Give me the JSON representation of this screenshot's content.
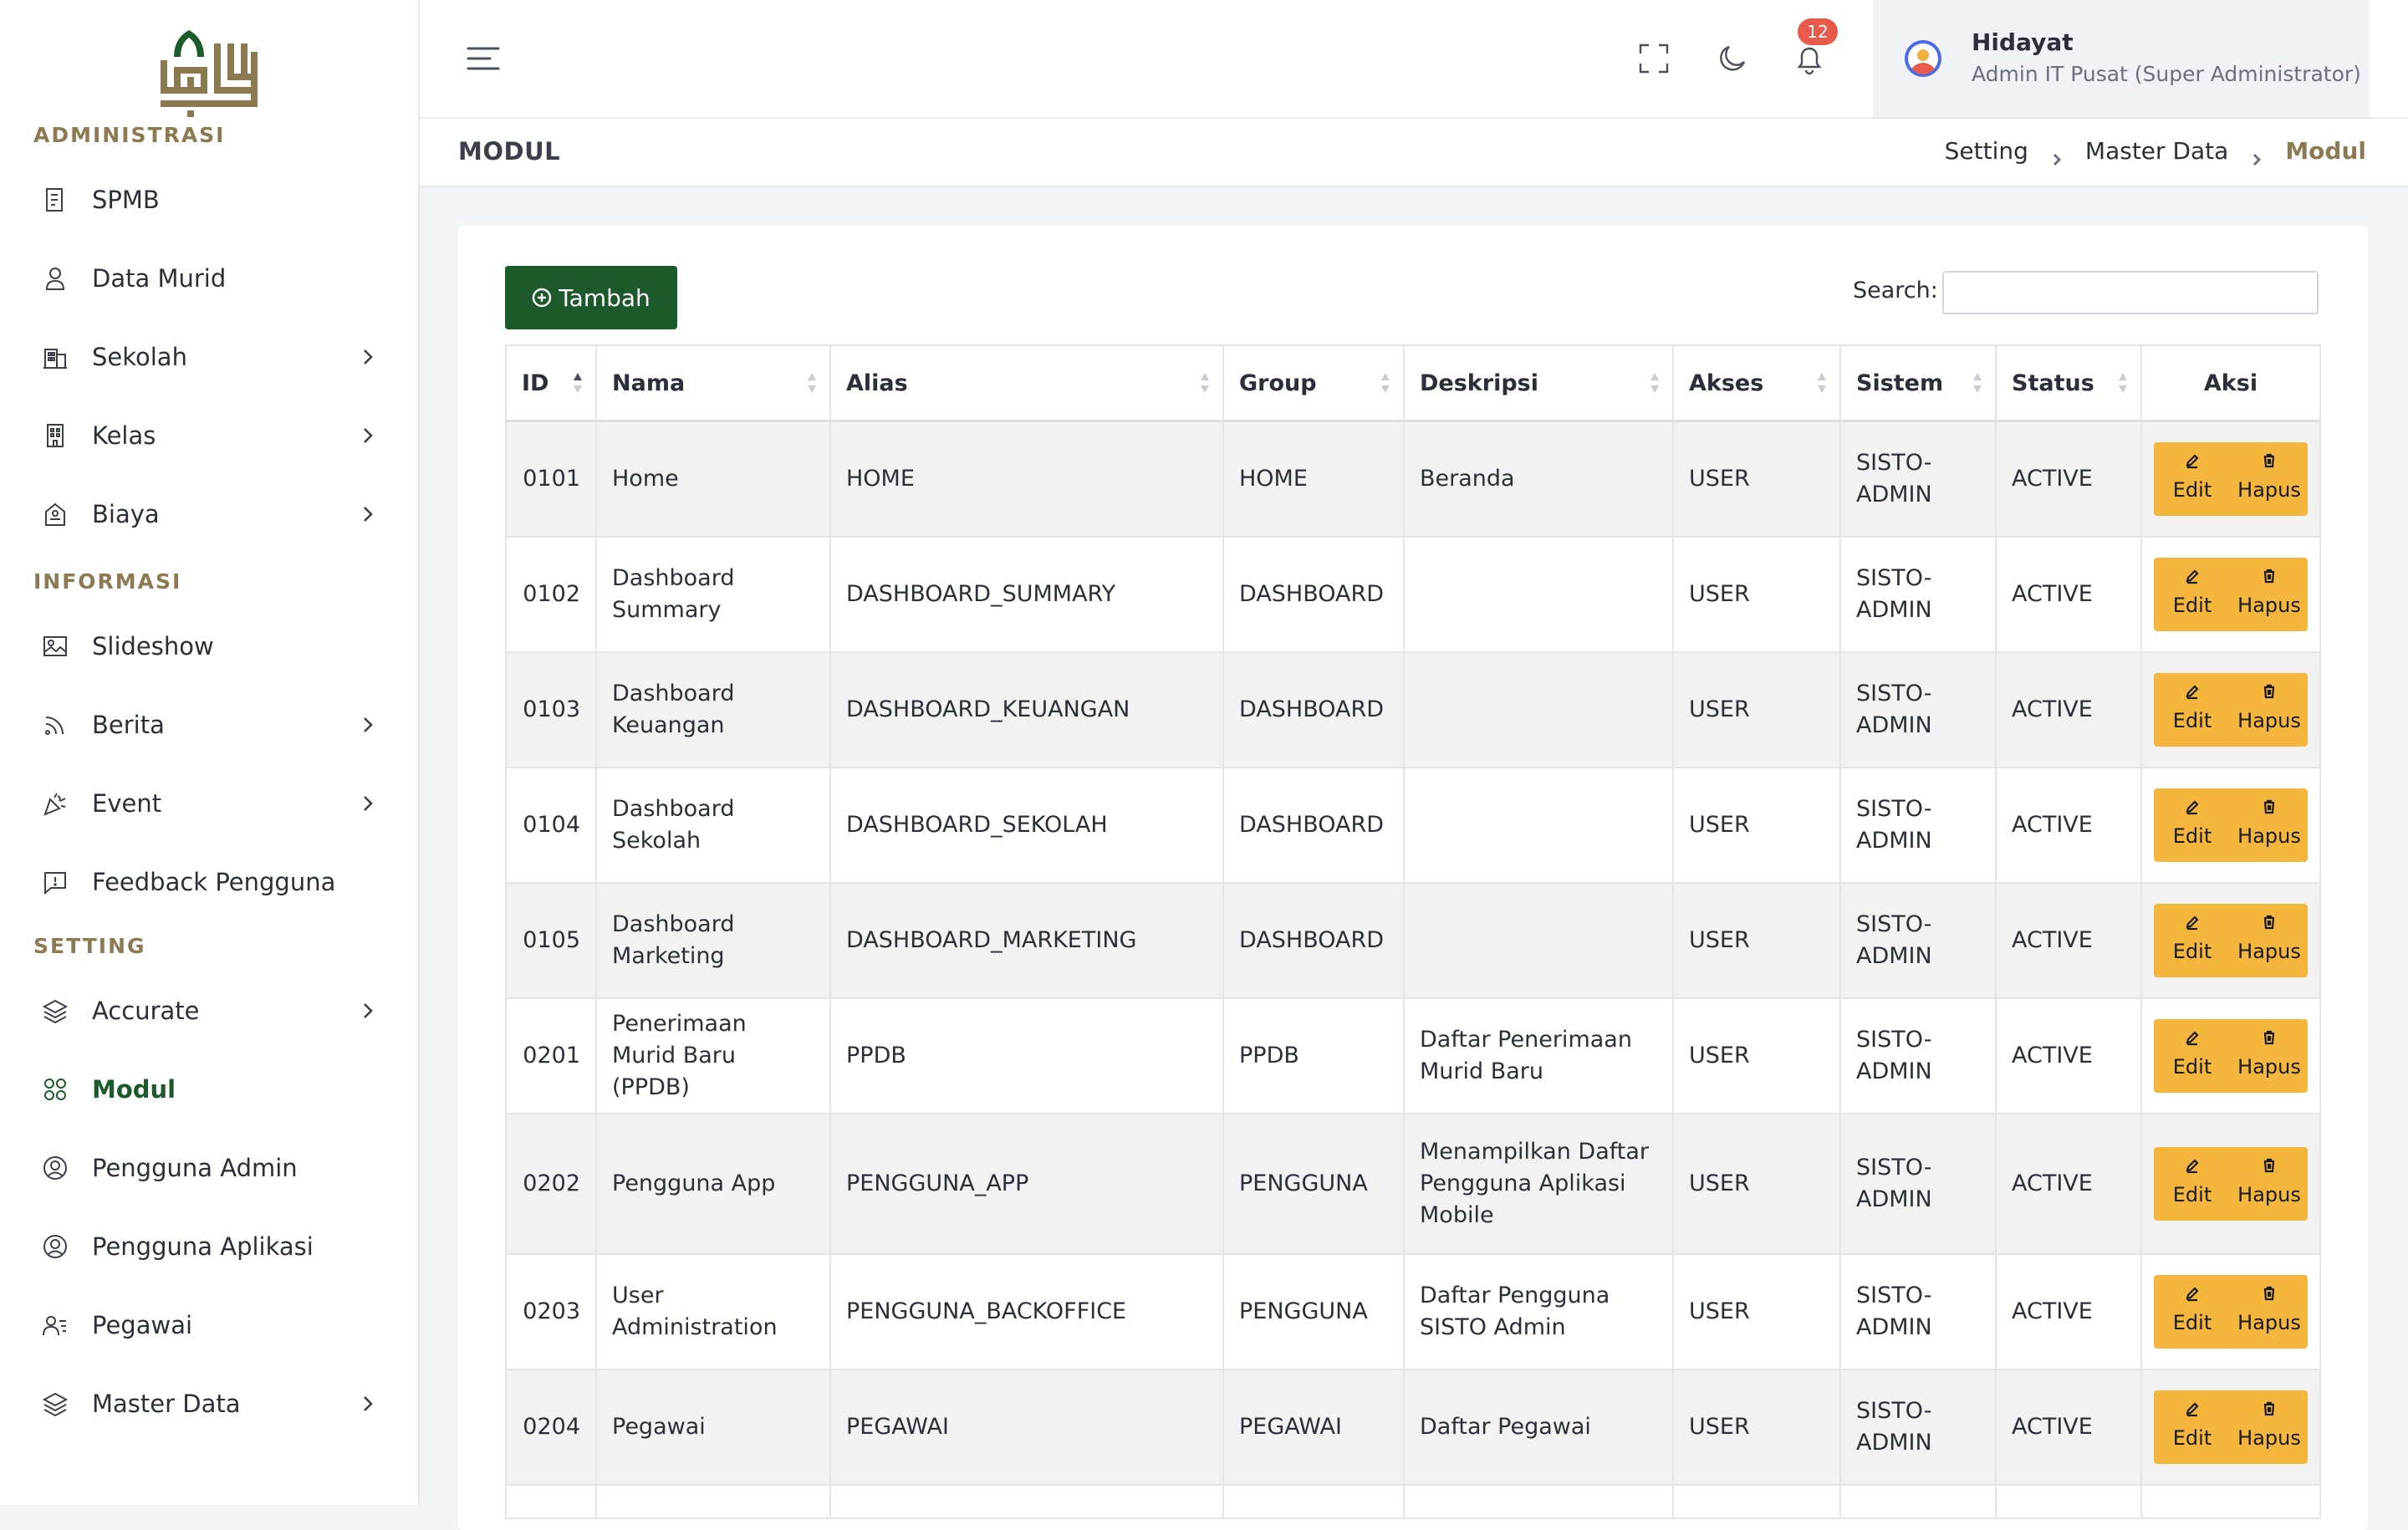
{
  "brand": {
    "logo_text": ""
  },
  "sidebar": {
    "sections": [
      {
        "title": "ADMINISTRASI",
        "items": [
          {
            "label": "SPMB",
            "icon": "document-icon",
            "chevron": false
          },
          {
            "label": "Data Murid",
            "icon": "user-icon",
            "chevron": false
          },
          {
            "label": "Sekolah",
            "icon": "building-icon",
            "chevron": true
          },
          {
            "label": "Kelas",
            "icon": "office-icon",
            "chevron": true
          },
          {
            "label": "Biaya",
            "icon": "receipt-icon",
            "chevron": true
          }
        ]
      },
      {
        "title": "INFORMASI",
        "items": [
          {
            "label": "Slideshow",
            "icon": "image-icon",
            "chevron": false
          },
          {
            "label": "Berita",
            "icon": "rss-icon",
            "chevron": true
          },
          {
            "label": "Event",
            "icon": "party-icon",
            "chevron": true
          },
          {
            "label": "Feedback Pengguna",
            "icon": "feedback-icon",
            "chevron": false
          }
        ]
      },
      {
        "title": "SETTING",
        "items": [
          {
            "label": "Accurate",
            "icon": "layers-icon",
            "chevron": true
          },
          {
            "label": "Modul",
            "icon": "modules-icon",
            "chevron": false,
            "active": true
          },
          {
            "label": "Pengguna Admin",
            "icon": "user-circle-icon",
            "chevron": false
          },
          {
            "label": "Pengguna Aplikasi",
            "icon": "user-circle-icon",
            "chevron": false
          },
          {
            "label": "Pegawai",
            "icon": "staff-icon",
            "chevron": false
          },
          {
            "label": "Master Data",
            "icon": "layers-icon",
            "chevron": true
          }
        ]
      }
    ]
  },
  "header": {
    "notification_count": "12",
    "user_name": "Hidayat",
    "user_role": "Admin IT Pusat (Super Administrator)"
  },
  "page": {
    "title": "MODUL",
    "breadcrumb": [
      "Setting",
      "Master Data",
      "Modul"
    ]
  },
  "toolbar": {
    "add_label": "Tambah",
    "search_label": "Search:",
    "search_value": ""
  },
  "table": {
    "columns": [
      "ID",
      "Nama",
      "Alias",
      "Group",
      "Deskripsi",
      "Akses",
      "Sistem",
      "Status",
      "Aksi"
    ],
    "edit_label": "Edit",
    "delete_label": "Hapus",
    "rows": [
      {
        "id": "0101",
        "nama": "Home",
        "alias": "HOME",
        "group": "HOME",
        "deskripsi": "Beranda",
        "akses": "USER",
        "sistem": "SISTO-ADMIN",
        "status": "ACTIVE"
      },
      {
        "id": "0102",
        "nama": "Dashboard Summary",
        "alias": "DASHBOARD_SUMMARY",
        "group": "DASHBOARD",
        "deskripsi": "",
        "akses": "USER",
        "sistem": "SISTO-ADMIN",
        "status": "ACTIVE"
      },
      {
        "id": "0103",
        "nama": "Dashboard Keuangan",
        "alias": "DASHBOARD_KEUANGAN",
        "group": "DASHBOARD",
        "deskripsi": "",
        "akses": "USER",
        "sistem": "SISTO-ADMIN",
        "status": "ACTIVE"
      },
      {
        "id": "0104",
        "nama": "Dashboard Sekolah",
        "alias": "DASHBOARD_SEKOLAH",
        "group": "DASHBOARD",
        "deskripsi": "",
        "akses": "USER",
        "sistem": "SISTO-ADMIN",
        "status": "ACTIVE"
      },
      {
        "id": "0105",
        "nama": "Dashboard Marketing",
        "alias": "DASHBOARD_MARKETING",
        "group": "DASHBOARD",
        "deskripsi": "",
        "akses": "USER",
        "sistem": "SISTO-ADMIN",
        "status": "ACTIVE"
      },
      {
        "id": "0201",
        "nama": "Penerimaan Murid Baru (PPDB)",
        "alias": "PPDB",
        "group": "PPDB",
        "deskripsi": "Daftar Penerimaan Murid Baru",
        "akses": "USER",
        "sistem": "SISTO-ADMIN",
        "status": "ACTIVE"
      },
      {
        "id": "0202",
        "nama": "Pengguna App",
        "alias": "PENGGUNA_APP",
        "group": "PENGGUNA",
        "deskripsi": "Menampilkan Daftar Pengguna Aplikasi Mobile",
        "akses": "USER",
        "sistem": "SISTO-ADMIN",
        "status": "ACTIVE"
      },
      {
        "id": "0203",
        "nama": "User Administration",
        "alias": "PENGGUNA_BACKOFFICE",
        "group": "PENGGUNA",
        "deskripsi": "Daftar Pengguna SISTO Admin",
        "akses": "USER",
        "sistem": "SISTO-ADMIN",
        "status": "ACTIVE"
      },
      {
        "id": "0204",
        "nama": "Pegawai",
        "alias": "PEGAWAI",
        "group": "PEGAWAI",
        "deskripsi": "Daftar Pegawai",
        "akses": "USER",
        "sistem": "SISTO-ADMIN",
        "status": "ACTIVE"
      },
      {
        "id": "",
        "nama": "",
        "alias": "",
        "group": "",
        "deskripsi": "",
        "akses": "",
        "sistem": "",
        "status": ""
      }
    ]
  },
  "colors": {
    "brand_green": "#1d5a2b",
    "brand_gold": "#8b7a52",
    "action_yellow": "#f4b63c",
    "badge_red": "#e85a4a"
  }
}
